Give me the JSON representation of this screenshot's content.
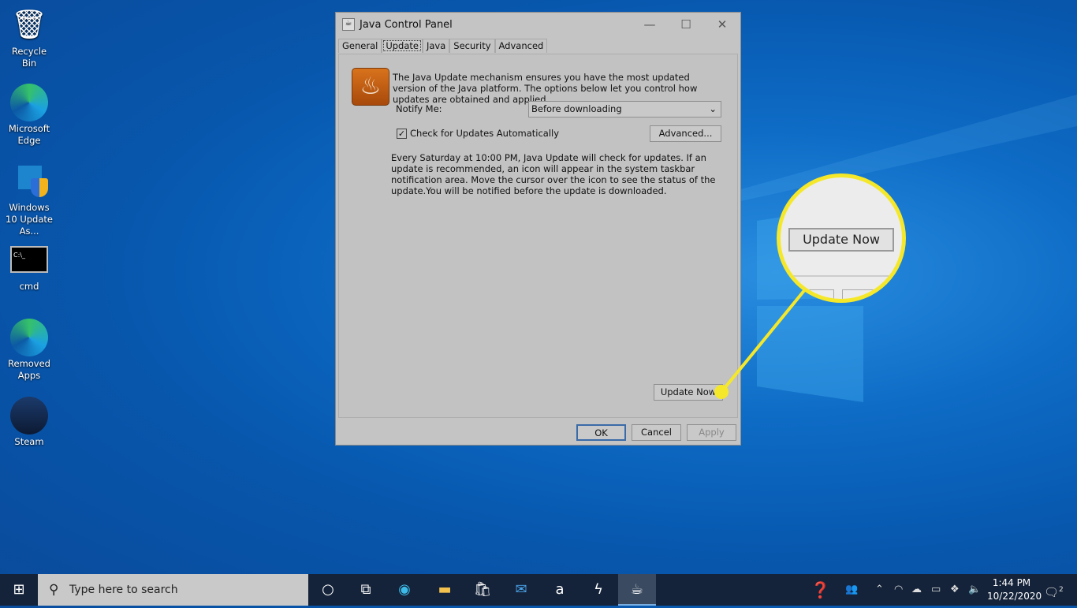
{
  "desktop": {
    "icons": [
      {
        "label": "Recycle Bin",
        "icon": "recycle-bin-icon"
      },
      {
        "label": "Microsoft Edge",
        "icon": "edge-icon"
      },
      {
        "label": "Windows 10 Update As...",
        "icon": "windows-update-icon"
      },
      {
        "label": "cmd",
        "icon": "cmd-icon"
      },
      {
        "label": "Removed Apps",
        "icon": "edge-icon"
      },
      {
        "label": "Steam",
        "icon": "steam-icon"
      }
    ]
  },
  "window": {
    "title": "Java Control Panel",
    "tabs": [
      "General",
      "Update",
      "Java",
      "Security",
      "Advanced"
    ],
    "active_tab": "Update",
    "intro": "The Java Update mechanism ensures you have the most updated version of the Java platform. The options below let you control how updates are obtained and applied.",
    "notify_label": "Notify Me:",
    "notify_value": "Before downloading",
    "check_auto_label": "Check for Updates Automatically",
    "check_auto": true,
    "advanced_button": "Advanced...",
    "schedule_text": "Every Saturday at 10:00 PM, Java Update will check for updates. If an update is recommended, an icon will appear in the system taskbar notification area. Move the cursor over the icon to see the status of the update.You will be notified before the update is downloaded.",
    "update_now": "Update Now",
    "ok": "OK",
    "cancel": "Cancel",
    "apply": "Apply"
  },
  "callout": {
    "label": "Update Now",
    "color": "#f5e82a"
  },
  "taskbar": {
    "search_placeholder": "Type here to search",
    "time": "1:44 PM",
    "date": "10/22/2020",
    "notifications": "2"
  }
}
